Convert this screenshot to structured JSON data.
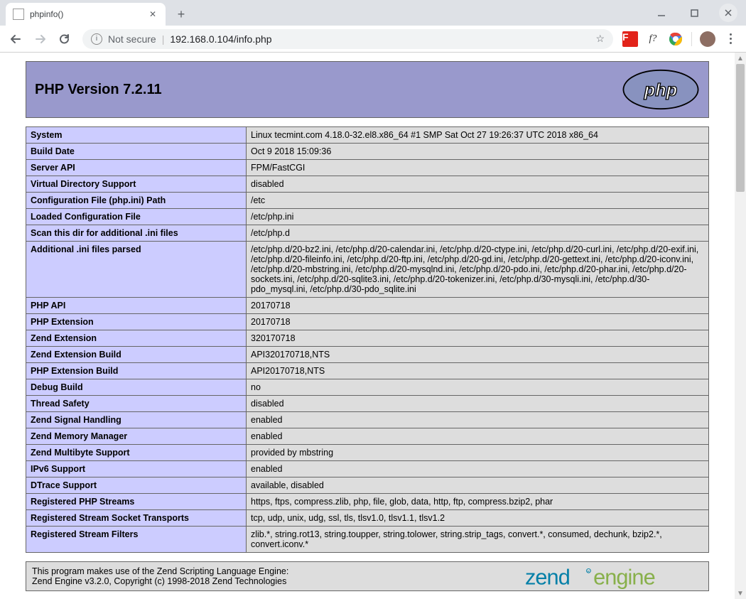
{
  "browser": {
    "tab_title": "phpinfo()",
    "url_notsecure_label": "Not secure",
    "url": "192.168.0.104/info.php"
  },
  "php": {
    "version_label": "PHP Version 7.2.11",
    "rows": [
      {
        "k": "System",
        "v": "Linux tecmint.com 4.18.0-32.el8.x86_64 #1 SMP Sat Oct 27 19:26:37 UTC 2018 x86_64"
      },
      {
        "k": "Build Date",
        "v": "Oct 9 2018 15:09:36"
      },
      {
        "k": "Server API",
        "v": "FPM/FastCGI"
      },
      {
        "k": "Virtual Directory Support",
        "v": "disabled"
      },
      {
        "k": "Configuration File (php.ini) Path",
        "v": "/etc"
      },
      {
        "k": "Loaded Configuration File",
        "v": "/etc/php.ini"
      },
      {
        "k": "Scan this dir for additional .ini files",
        "v": "/etc/php.d"
      },
      {
        "k": "Additional .ini files parsed",
        "v": "/etc/php.d/20-bz2.ini, /etc/php.d/20-calendar.ini, /etc/php.d/20-ctype.ini, /etc/php.d/20-curl.ini, /etc/php.d/20-exif.ini, /etc/php.d/20-fileinfo.ini, /etc/php.d/20-ftp.ini, /etc/php.d/20-gd.ini, /etc/php.d/20-gettext.ini, /etc/php.d/20-iconv.ini, /etc/php.d/20-mbstring.ini, /etc/php.d/20-mysqlnd.ini, /etc/php.d/20-pdo.ini, /etc/php.d/20-phar.ini, /etc/php.d/20-sockets.ini, /etc/php.d/20-sqlite3.ini, /etc/php.d/20-tokenizer.ini, /etc/php.d/30-mysqli.ini, /etc/php.d/30-pdo_mysql.ini, /etc/php.d/30-pdo_sqlite.ini"
      },
      {
        "k": "PHP API",
        "v": "20170718"
      },
      {
        "k": "PHP Extension",
        "v": "20170718"
      },
      {
        "k": "Zend Extension",
        "v": "320170718"
      },
      {
        "k": "Zend Extension Build",
        "v": "API320170718,NTS"
      },
      {
        "k": "PHP Extension Build",
        "v": "API20170718,NTS"
      },
      {
        "k": "Debug Build",
        "v": "no"
      },
      {
        "k": "Thread Safety",
        "v": "disabled"
      },
      {
        "k": "Zend Signal Handling",
        "v": "enabled"
      },
      {
        "k": "Zend Memory Manager",
        "v": "enabled"
      },
      {
        "k": "Zend Multibyte Support",
        "v": "provided by mbstring"
      },
      {
        "k": "IPv6 Support",
        "v": "enabled"
      },
      {
        "k": "DTrace Support",
        "v": "available, disabled"
      },
      {
        "k": "Registered PHP Streams",
        "v": "https, ftps, compress.zlib, php, file, glob, data, http, ftp, compress.bzip2, phar"
      },
      {
        "k": "Registered Stream Socket Transports",
        "v": "tcp, udp, unix, udg, ssl, tls, tlsv1.0, tlsv1.1, tlsv1.2"
      },
      {
        "k": "Registered Stream Filters",
        "v": "zlib.*, string.rot13, string.toupper, string.tolower, string.strip_tags, convert.*, consumed, dechunk, bzip2.*, convert.iconv.*"
      }
    ],
    "zend_line1": "This program makes use of the Zend Scripting Language Engine:",
    "zend_line2": "Zend Engine v3.2.0, Copyright (c) 1998-2018 Zend Technologies"
  }
}
